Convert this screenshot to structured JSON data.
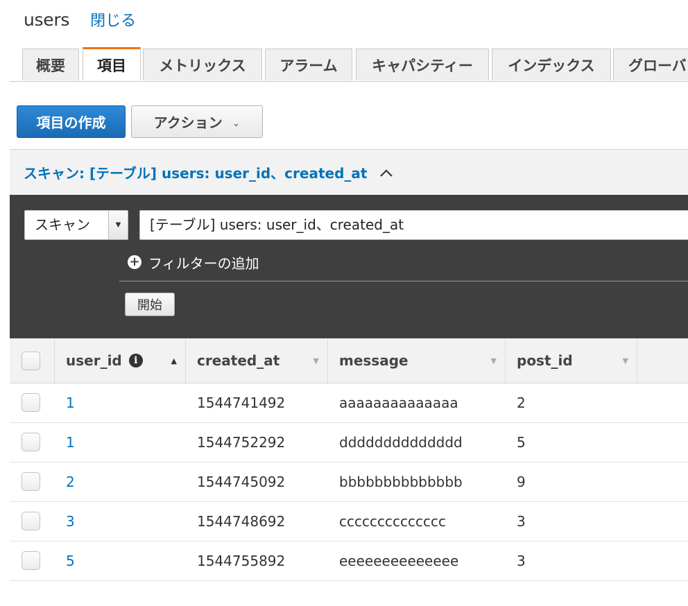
{
  "header": {
    "title": "users",
    "close_label": "閉じる"
  },
  "tabs": [
    "概要",
    "項目",
    "メトリックス",
    "アラーム",
    "キャパシティー",
    "インデックス",
    "グローバ"
  ],
  "toolbar": {
    "create_label": "項目の作成",
    "action_label": "アクション"
  },
  "scan": {
    "header_label": "スキャン: [テーブル] users: user_id、created_at",
    "mode": "スキャン",
    "target": "[テーブル] users: user_id、created_at",
    "add_filter_label": "フィルターの追加",
    "start_label": "開始"
  },
  "table": {
    "columns": [
      "user_id",
      "created_at",
      "message",
      "post_id"
    ],
    "rows": [
      {
        "user_id": "1",
        "created_at": "1544741492",
        "message": "aaaaaaaaaaaaaa",
        "post_id": "2"
      },
      {
        "user_id": "1",
        "created_at": "1544752292",
        "message": "dddddddddddddd",
        "post_id": "5"
      },
      {
        "user_id": "2",
        "created_at": "1544745092",
        "message": "bbbbbbbbbbbbbb",
        "post_id": "9"
      },
      {
        "user_id": "3",
        "created_at": "1544748692",
        "message": "cccccccccccccc",
        "post_id": "3"
      },
      {
        "user_id": "5",
        "created_at": "1544755892",
        "message": "eeeeeeeeeeeeee",
        "post_id": "3"
      }
    ]
  },
  "colors": {
    "accent_blue": "#0073bb",
    "primary_button": "#1a6bb3",
    "active_tab_border": "#ec7211",
    "panel_dark": "#3f3f3f"
  },
  "icons": {
    "caret_up": "caret-up-icon",
    "info": "info-icon",
    "plus": "plus-circle-icon",
    "chevron": "chevron-down-icon"
  }
}
